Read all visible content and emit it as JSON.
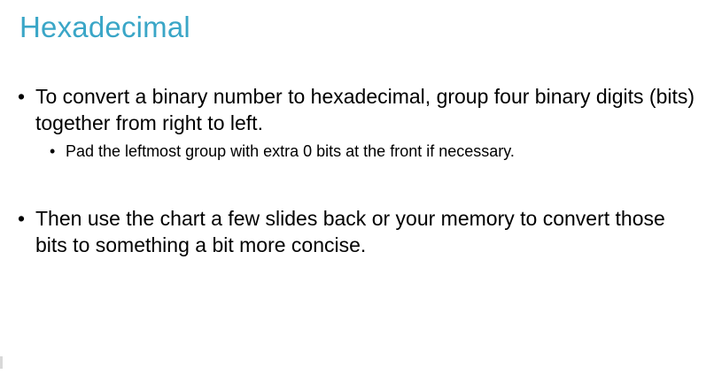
{
  "slide": {
    "title": "Hexadecimal",
    "bullets": [
      {
        "symbol": "•",
        "text": "To convert a binary number to hexadecimal, group four binary digits (bits) together from right to left.",
        "sub_bullets": [
          {
            "symbol": "•",
            "text": "Pad the leftmost group with extra 0 bits at the front if necessary."
          }
        ]
      },
      {
        "symbol": "•",
        "text": "Then use the chart a few slides back or your memory to convert those bits to something a bit more concise."
      }
    ]
  }
}
